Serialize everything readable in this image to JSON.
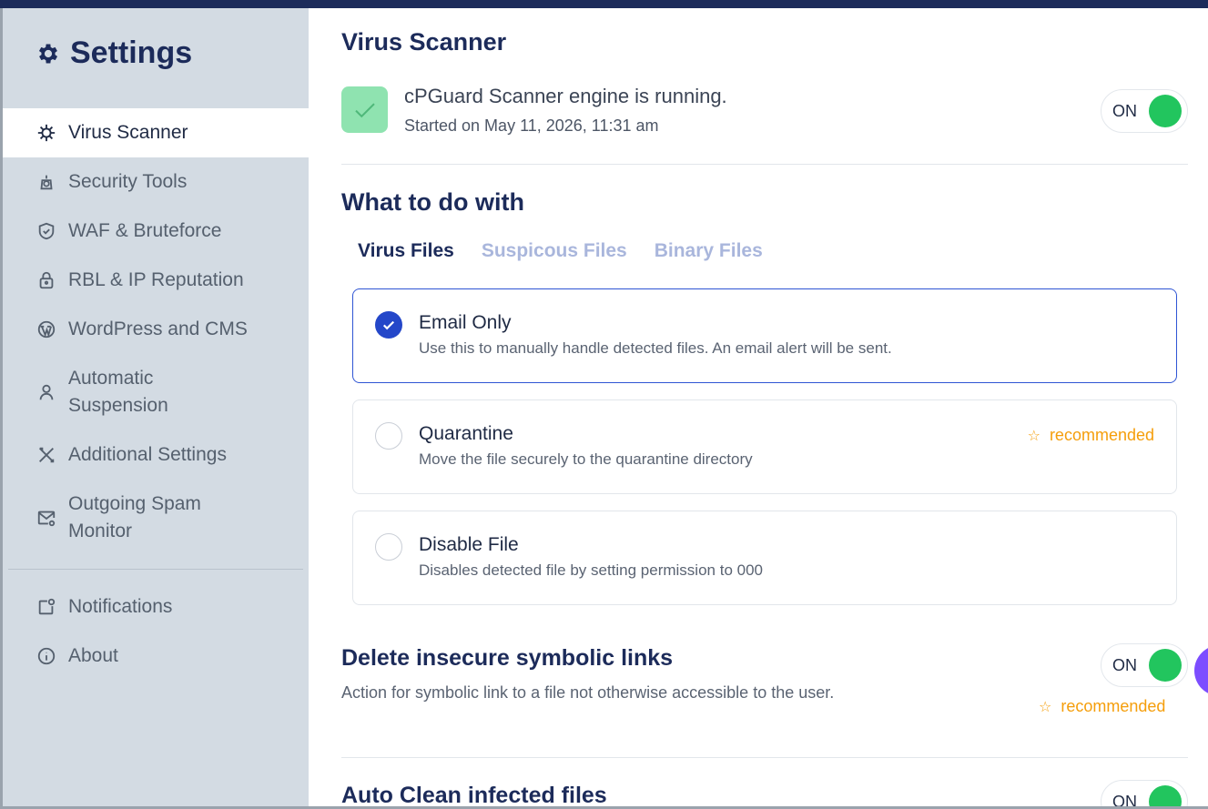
{
  "sidebar": {
    "title": "Settings",
    "items": [
      {
        "label": "Virus Scanner",
        "icon": "virus-icon",
        "active": true
      },
      {
        "label": "Security Tools",
        "icon": "security-camera-icon"
      },
      {
        "label": "WAF & Bruteforce",
        "icon": "shield-check-icon"
      },
      {
        "label": "RBL & IP Reputation",
        "icon": "lock-icon"
      },
      {
        "label": "WordPress and CMS",
        "icon": "wordpress-icon"
      },
      {
        "label": "Automatic Suspension",
        "icon": "user-icon"
      },
      {
        "label": "Additional Settings",
        "icon": "tools-icon"
      },
      {
        "label": "Outgoing Spam Monitor",
        "icon": "mail-settings-icon"
      }
    ],
    "footer_items": [
      {
        "label": "Notifications",
        "icon": "notification-icon"
      },
      {
        "label": "About",
        "icon": "info-icon"
      }
    ]
  },
  "main": {
    "title": "Virus Scanner",
    "engine": {
      "status": "cPGuard Scanner engine is running.",
      "started": "Started on May 11, 2026, 11:31 am",
      "toggle": "ON"
    },
    "what_to_do": {
      "heading": "What to do with",
      "tabs": [
        "Virus Files",
        "Suspicous Files",
        "Binary Files"
      ],
      "options": [
        {
          "title": "Email Only",
          "desc": "Use this to manually handle detected files. An email alert will be sent.",
          "selected": true
        },
        {
          "title": "Quarantine",
          "desc": "Move the file securely to the quarantine directory",
          "badge": "recommended"
        },
        {
          "title": "Disable File",
          "desc": "Disables detected file by setting permission to 000"
        }
      ]
    },
    "symlinks": {
      "heading": "Delete insecure symbolic links",
      "desc": "Action for symbolic link to a file not otherwise accessible to the user.",
      "toggle": "ON",
      "badge": "recommended"
    },
    "auto_clean": {
      "heading": "Auto Clean infected files",
      "toggle": "ON"
    }
  },
  "colors": {
    "accent": "#2447c9",
    "brand_navy": "#1c2b5a",
    "toggle_on": "#22c55e",
    "recommended": "#f59e0b",
    "sidebar_bg": "#d3dbe3"
  }
}
